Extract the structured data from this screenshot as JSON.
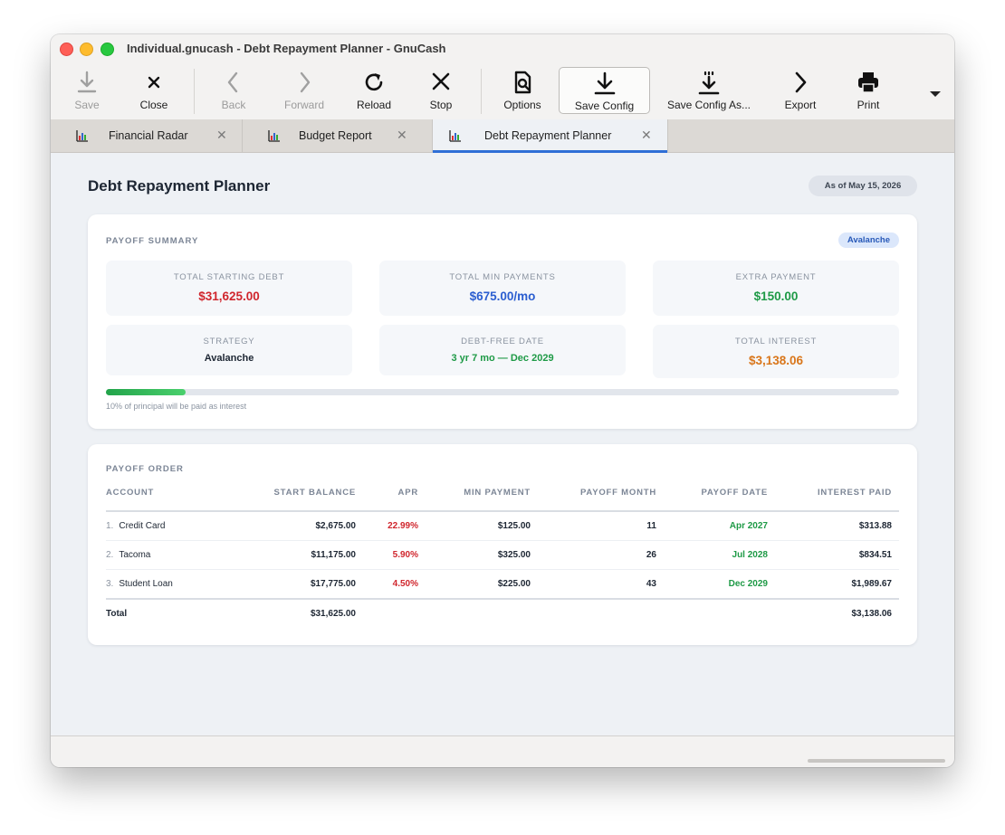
{
  "window": {
    "title": "Individual.gnucash - Debt Repayment Planner - GnuCash"
  },
  "toolbar": {
    "save": "Save",
    "close": "Close",
    "back": "Back",
    "forward": "Forward",
    "reload": "Reload",
    "stop": "Stop",
    "options": "Options",
    "save_config": "Save Config",
    "save_config_as": "Save Config As...",
    "export": "Export",
    "print": "Print"
  },
  "tabs": [
    {
      "label": "Financial Radar",
      "active": false
    },
    {
      "label": "Budget Report",
      "active": false
    },
    {
      "label": "Debt Repayment Planner",
      "active": true
    }
  ],
  "report": {
    "title": "Debt Repayment Planner",
    "as_of": "As of May 15, 2026",
    "summary": {
      "section_title": "PAYOFF SUMMARY",
      "strategy_badge": "Avalanche",
      "stats": [
        {
          "label": "TOTAL STARTING DEBT",
          "value": "$31,625.00",
          "color": "#d0262d"
        },
        {
          "label": "TOTAL MIN PAYMENTS",
          "value": "$675.00/mo",
          "color": "#2b5ed0"
        },
        {
          "label": "EXTRA PAYMENT",
          "value": "$150.00",
          "color": "#1e9a46"
        },
        {
          "label": "STRATEGY",
          "value": "Avalanche",
          "color": "#1d2633"
        },
        {
          "label": "DEBT-FREE DATE",
          "value": "3 yr 7 mo — Dec 2029",
          "color": "#1e9a46"
        },
        {
          "label": "TOTAL INTEREST",
          "value": "$3,138.06",
          "color": "#d9761a"
        }
      ],
      "interest_fraction": 0.1,
      "interest_caption": "10% of principal will be paid as interest"
    },
    "order": {
      "section_title": "PAYOFF ORDER",
      "columns": [
        "ACCOUNT",
        "START BALANCE",
        "APR",
        "MIN PAYMENT",
        "PAYOFF MONTH",
        "PAYOFF DATE",
        "INTEREST PAID"
      ],
      "rows": [
        {
          "index": "1.",
          "account": "Credit Card",
          "start_balance": "$2,675.00",
          "apr": "22.99%",
          "min_payment": "$125.00",
          "payoff_month": "11",
          "payoff_date": "Apr 2027",
          "interest_paid": "$313.88"
        },
        {
          "index": "2.",
          "account": "Tacoma",
          "start_balance": "$11,175.00",
          "apr": "5.90%",
          "min_payment": "$325.00",
          "payoff_month": "26",
          "payoff_date": "Jul 2028",
          "interest_paid": "$834.51"
        },
        {
          "index": "3.",
          "account": "Student Loan",
          "start_balance": "$17,775.00",
          "apr": "4.50%",
          "min_payment": "$225.00",
          "payoff_month": "43",
          "payoff_date": "Dec 2029",
          "interest_paid": "$1,989.67"
        }
      ],
      "total": {
        "label": "Total",
        "start_balance": "$31,625.00",
        "interest_paid": "$3,138.06"
      },
      "apr_color": "#d0262d",
      "date_color": "#1e9a46"
    }
  }
}
